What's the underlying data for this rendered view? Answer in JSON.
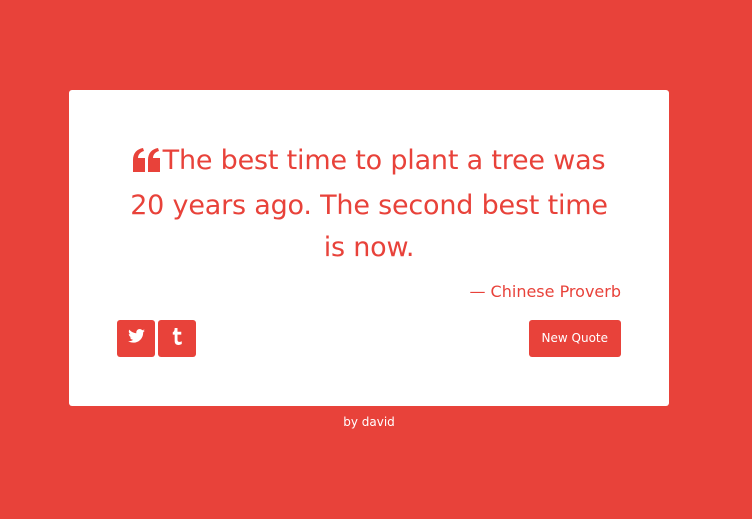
{
  "quote": {
    "text": "The best time to plant a tree was 20 years ago. The second best time is now.",
    "author": "— Chinese Proverb"
  },
  "buttons": {
    "twitter_icon": "twitter-icon",
    "tumblr_icon": "tumblr-icon",
    "new_quote_label": "New Quote"
  },
  "footer": {
    "credit": "by david"
  },
  "colors": {
    "accent": "#e8423a",
    "card": "#ffffff"
  }
}
